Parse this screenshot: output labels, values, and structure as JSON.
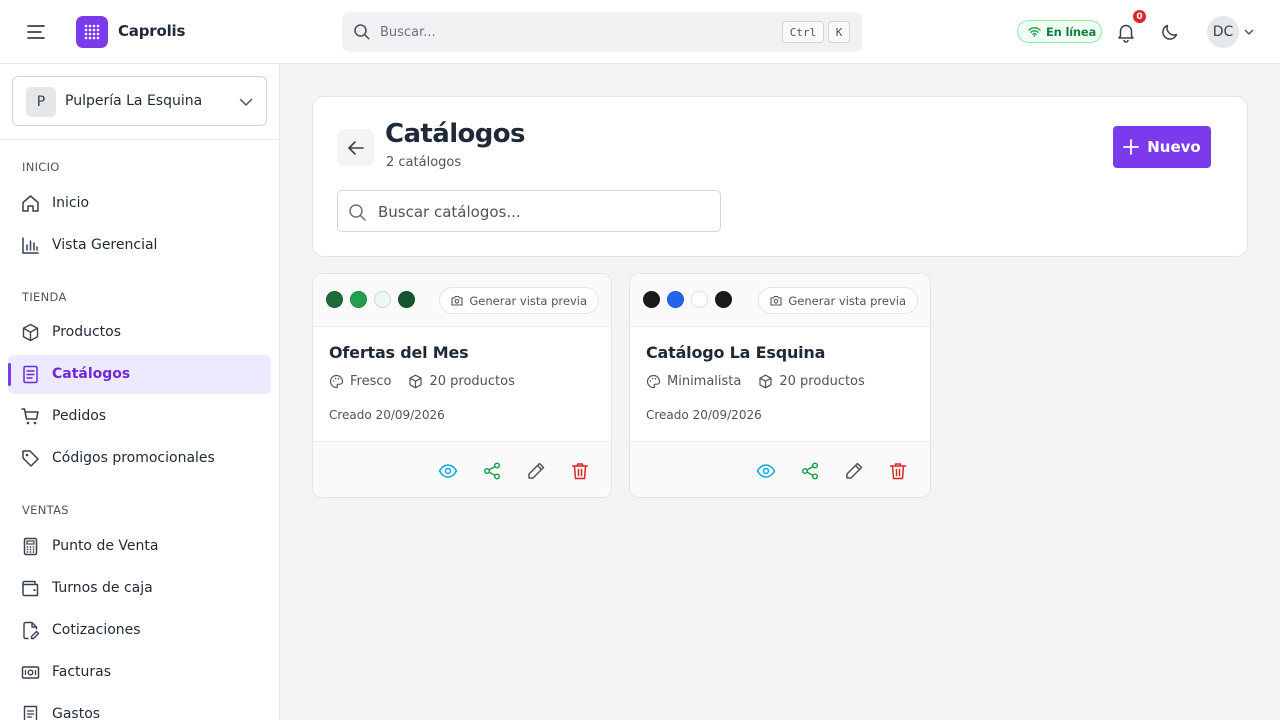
{
  "app": {
    "name": "Caprolis"
  },
  "topbar": {
    "search_placeholder": "Buscar...",
    "shortcut_ctrl": "Ctrl",
    "shortcut_key": "K",
    "status_label": "En línea",
    "notification_count": "0",
    "user_initials": "DC",
    "icons": [
      "menu-icon",
      "app-logo-icon",
      "search-icon",
      "wifi-icon",
      "bell-icon",
      "moon-icon",
      "chevron-down-icon"
    ]
  },
  "sidebar": {
    "store": {
      "initial": "P",
      "name": "Pulpería La Esquina"
    },
    "sections": [
      {
        "title": "INICIO",
        "items": [
          {
            "label": "Inicio",
            "icon": "home-icon"
          },
          {
            "label": "Vista Gerencial",
            "icon": "bar-chart-icon"
          }
        ]
      },
      {
        "title": "TIENDA",
        "items": [
          {
            "label": "Productos",
            "icon": "box-icon"
          },
          {
            "label": "Catálogos",
            "icon": "catalog-icon",
            "active": true
          },
          {
            "label": "Pedidos",
            "icon": "cart-icon"
          },
          {
            "label": "Códigos promocionales",
            "icon": "tag-icon"
          }
        ]
      },
      {
        "title": "VENTAS",
        "items": [
          {
            "label": "Punto de Venta",
            "icon": "calculator-icon"
          },
          {
            "label": "Turnos de caja",
            "icon": "wallet-icon"
          },
          {
            "label": "Cotizaciones",
            "icon": "file-edit-icon"
          },
          {
            "label": "Facturas",
            "icon": "banknote-icon"
          },
          {
            "label": "Gastos",
            "icon": "receipt-icon"
          }
        ]
      }
    ]
  },
  "page": {
    "title": "Catálogos",
    "subtitle": "2 catálogos",
    "new_button": "Nuevo",
    "search_placeholder": "Buscar catálogos..."
  },
  "catalogs": [
    {
      "swatches": [
        "#1e6b3a",
        "#22a04b",
        "#eef8f0",
        "#15552e"
      ],
      "preview_label": "Generar vista previa",
      "title": "Ofertas del Mes",
      "theme": "Fresco",
      "products": "20 productos",
      "created": "Creado 20/09/2026"
    },
    {
      "swatches": [
        "#1a1a1a",
        "#2563eb",
        "#ffffff",
        "#1a1a1a"
      ],
      "preview_label": "Generar vista previa",
      "title": "Catálogo La Esquina",
      "theme": "Minimalista",
      "products": "20 productos",
      "created": "Creado 20/09/2026"
    }
  ],
  "colors": {
    "accent": "#7c3aed",
    "accent_soft": "#ede9fe",
    "online": "#15803d",
    "badge": "#dc2626",
    "view": "#0ea5e9",
    "share": "#16a34a",
    "edit": "#52525b",
    "delete": "#dc2626"
  }
}
